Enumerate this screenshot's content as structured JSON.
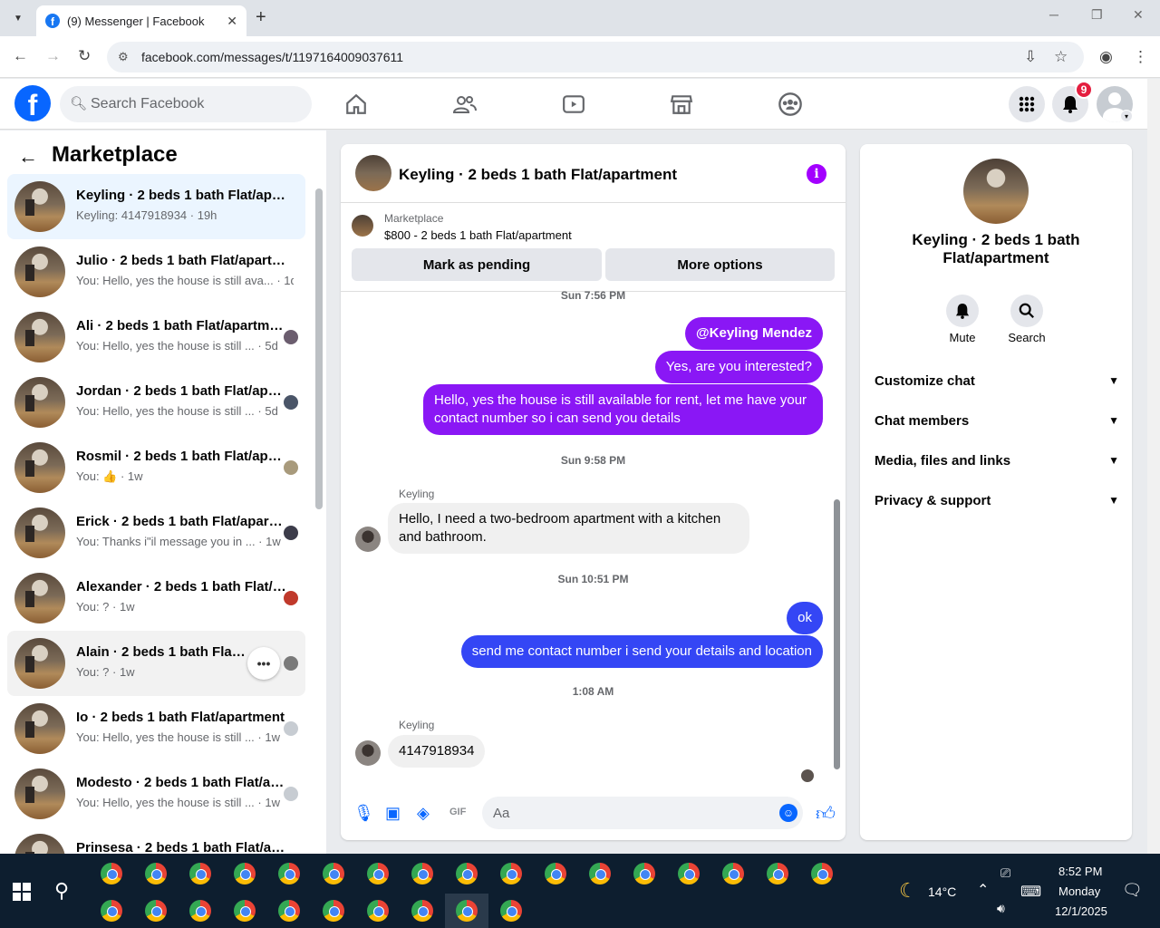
{
  "browser": {
    "tab_title": "(9) Messenger | Facebook",
    "url": "facebook.com/messages/t/1197164009037611"
  },
  "fb": {
    "search_placeholder": "Search Facebook",
    "notification_count": "9"
  },
  "left": {
    "title": "Marketplace",
    "chats": [
      {
        "name": "Keyling · 2 beds 1 bath Flat/apartment",
        "sub": "Keyling: 4147918934 · 19h"
      },
      {
        "name": "Julio · 2 beds 1 bath Flat/apartment",
        "sub": "You: Hello, yes the house is still ava... · 1d"
      },
      {
        "name": "Ali · 2 beds 1 bath Flat/apartment",
        "sub": "You: Hello, yes the house is still ... · 5d"
      },
      {
        "name": "Jordan · 2 beds 1 bath Flat/apartment",
        "sub": "You: Hello, yes the house is still ... · 5d"
      },
      {
        "name": "Rosmil · 2 beds 1 bath Flat/apartment",
        "sub": "You: 👍 · 1w"
      },
      {
        "name": "Erick · 2 beds 1 bath Flat/apartment",
        "sub": "You: Thanks i\"il message you in ... · 1w"
      },
      {
        "name": "Alexander · 2 beds 1 bath Flat/apartment",
        "sub": "You: ? · 1w"
      },
      {
        "name": "Alain · 2 beds 1 bath Flat/apartment",
        "sub": "You: ? · 1w"
      },
      {
        "name": "Io · 2 beds 1 bath Flat/apartment",
        "sub": "You: Hello, yes the house is still ... · 1w"
      },
      {
        "name": "Modesto · 2 beds 1 bath Flat/apartment",
        "sub": "You: Hello, yes the house is still ... · 1w"
      },
      {
        "name": "Prinsesa · 2 beds 1 bath Flat/apartment",
        "sub": ""
      }
    ]
  },
  "convo": {
    "title": "Keyling · 2 beds 1 bath Flat/apartment",
    "marketplace_label": "Marketplace",
    "listing": "$800 - 2 beds 1 bath Flat/apartment",
    "btn_pending": "Mark as pending",
    "btn_more": "More options",
    "ts1": "Sun 7:56 PM",
    "msg1": "@Keyling Mendez",
    "msg2": "Yes, are you interested?",
    "msg3": "Hello, yes the house is still available for rent, let me have your contact number so i can send you details",
    "ts2": "Sun 9:58 PM",
    "sender": "Keyling",
    "msg4": "Hello, I need a two-bedroom apartment with a kitchen and bathroom.",
    "ts3": "Sun 10:51 PM",
    "msg5": "ok",
    "msg6": "send me contact number i send your details and location",
    "ts4": "1:08 AM",
    "msg7": "4147918934",
    "composer_placeholder": "Aa"
  },
  "right": {
    "name": "Keyling · 2 beds 1 bath Flat/apartment",
    "mute": "Mute",
    "search": "Search",
    "sections": [
      "Customize chat",
      "Chat members",
      "Media, files and links",
      "Privacy & support"
    ]
  },
  "taskbar": {
    "temp": "14°C",
    "time": "8:52 PM",
    "day": "Monday",
    "date": "12/1/2025"
  }
}
